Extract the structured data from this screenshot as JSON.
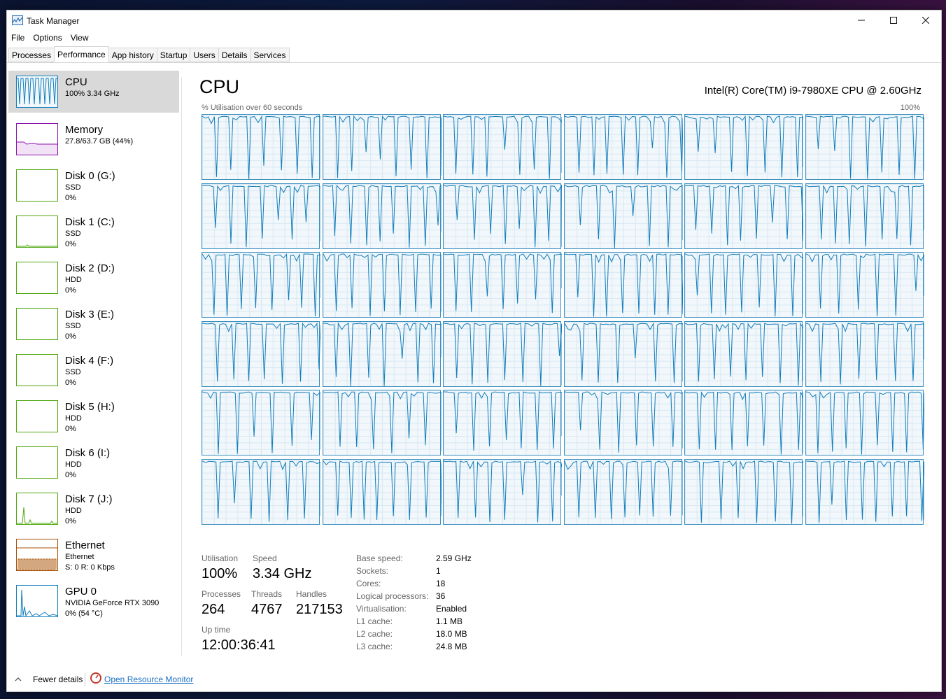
{
  "window": {
    "title": "Task Manager",
    "min_icon": "minimize-icon",
    "max_icon": "maximize-icon",
    "close_icon": "close-icon"
  },
  "menu": [
    "File",
    "Options",
    "View"
  ],
  "tabs": [
    "Processes",
    "Performance",
    "App history",
    "Startup",
    "Users",
    "Details",
    "Services"
  ],
  "active_tab": "Performance",
  "sidebar": {
    "items": [
      {
        "title": "CPU",
        "sub1": "100%  3.34 GHz",
        "sub2": "",
        "color": "#117dbb",
        "selected": true
      },
      {
        "title": "Memory",
        "sub1": "27.8/63.7 GB (44%)",
        "sub2": "",
        "color": "#8b12ae"
      },
      {
        "title": "Disk 0 (G:)",
        "sub1": "SSD",
        "sub2": "0%",
        "color": "#4da60c"
      },
      {
        "title": "Disk 1 (C:)",
        "sub1": "SSD",
        "sub2": "0%",
        "color": "#4da60c"
      },
      {
        "title": "Disk 2 (D:)",
        "sub1": "HDD",
        "sub2": "0%",
        "color": "#4da60c"
      },
      {
        "title": "Disk 3 (E:)",
        "sub1": "SSD",
        "sub2": "0%",
        "color": "#4da60c"
      },
      {
        "title": "Disk 4 (F:)",
        "sub1": "SSD",
        "sub2": "0%",
        "color": "#4da60c"
      },
      {
        "title": "Disk 5 (H:)",
        "sub1": "HDD",
        "sub2": "0%",
        "color": "#4da60c"
      },
      {
        "title": "Disk 6 (I:)",
        "sub1": "HDD",
        "sub2": "0%",
        "color": "#4da60c"
      },
      {
        "title": "Disk 7 (J:)",
        "sub1": "HDD",
        "sub2": "0%",
        "color": "#4da60c"
      },
      {
        "title": "Ethernet",
        "sub1": "Ethernet",
        "sub2": "S: 0  R: 0 Kbps",
        "color": "#a74f01"
      },
      {
        "title": "GPU 0",
        "sub1": "NVIDIA GeForce RTX 3090",
        "sub2": "0%  (54 °C)",
        "color": "#117dbb"
      }
    ]
  },
  "main": {
    "title": "CPU",
    "model": "Intel(R) Core(TM) i9-7980XE CPU @ 2.60GHz",
    "graph_label": "% Utilisation over 60 seconds",
    "graph_max": "100%",
    "core_count": 36,
    "line_color": "#117dbb"
  },
  "stats": {
    "utilisation_label": "Utilisation",
    "utilisation": "100%",
    "speed_label": "Speed",
    "speed": "3.34 GHz",
    "processes_label": "Processes",
    "processes": "264",
    "threads_label": "Threads",
    "threads": "4767",
    "handles_label": "Handles",
    "handles": "217153",
    "uptime_label": "Up time",
    "uptime": "12:00:36:41"
  },
  "specs": [
    {
      "label": "Base speed:",
      "value": "2.59 GHz"
    },
    {
      "label": "Sockets:",
      "value": "1"
    },
    {
      "label": "Cores:",
      "value": "18"
    },
    {
      "label": "Logical processors:",
      "value": "36"
    },
    {
      "label": "Virtualisation:",
      "value": "Enabled"
    },
    {
      "label": "L1 cache:",
      "value": "1.1 MB"
    },
    {
      "label": "L2 cache:",
      "value": "18.0 MB"
    },
    {
      "label": "L3 cache:",
      "value": "24.8 MB"
    }
  ],
  "footer": {
    "fewer_details": "Fewer details",
    "resource_monitor": "Open Resource Monitor"
  }
}
